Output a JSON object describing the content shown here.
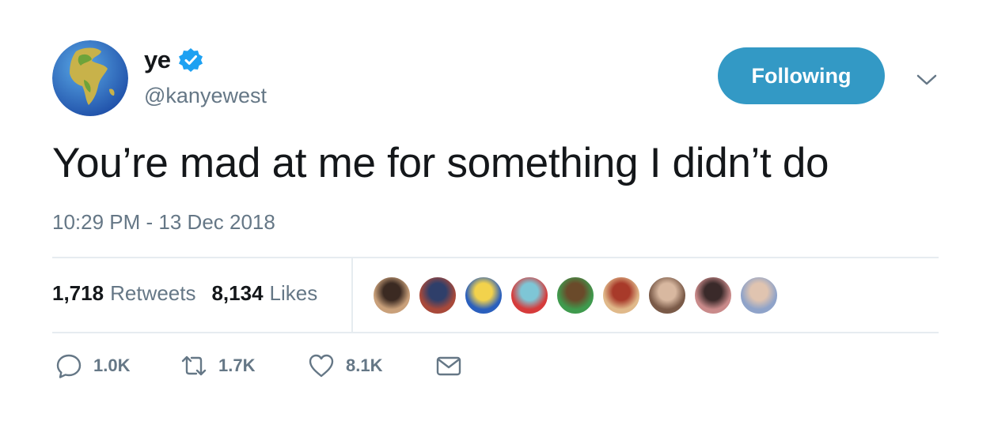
{
  "user": {
    "display_name": "ye",
    "handle": "@kanyewest",
    "avatar": "earth-globe-africa-europe",
    "verified": true
  },
  "follow_button": {
    "label": "Following",
    "color": "#3399c5"
  },
  "menu": {
    "icon": "chevron-down-icon"
  },
  "tweet": {
    "text": "You’re mad at me for something I didn’t do",
    "timestamp": "10:29 PM - 13 Dec 2018"
  },
  "stats": {
    "retweets": {
      "count": "1,718",
      "label": "Retweets"
    },
    "likes": {
      "count": "8,134",
      "label": "Likes"
    }
  },
  "likers": [
    {
      "name": "liker-avatar-1",
      "colors": [
        "#c9a07a",
        "#3b2a22"
      ]
    },
    {
      "name": "liker-avatar-2",
      "colors": [
        "#a8493a",
        "#2f3f6a"
      ]
    },
    {
      "name": "liker-avatar-3",
      "colors": [
        "#2a5fbd",
        "#f2d24c"
      ]
    },
    {
      "name": "liker-avatar-4",
      "colors": [
        "#d63b3b",
        "#7ec6d6"
      ]
    },
    {
      "name": "liker-avatar-5",
      "colors": [
        "#3f9a4d",
        "#6a4a2a"
      ]
    },
    {
      "name": "liker-avatar-6",
      "colors": [
        "#e0b98a",
        "#a83a2a"
      ]
    },
    {
      "name": "liker-avatar-7",
      "colors": [
        "#7a5a48",
        "#d8b8a0"
      ]
    },
    {
      "name": "liker-avatar-8",
      "colors": [
        "#c98a8a",
        "#3a2a2a"
      ]
    },
    {
      "name": "liker-avatar-9",
      "colors": [
        "#8fa3c9",
        "#e0c4b0"
      ]
    }
  ],
  "actions": {
    "reply": {
      "icon": "reply-icon",
      "count": "1.0K"
    },
    "retweet": {
      "icon": "retweet-icon",
      "count": "1.7K"
    },
    "like": {
      "icon": "heart-icon",
      "count": "8.1K"
    },
    "message": {
      "icon": "envelope-icon"
    }
  },
  "colors": {
    "text": "#14171a",
    "secondary": "#657786",
    "divider": "#e6ecf0",
    "verified": "#1da1f2"
  }
}
